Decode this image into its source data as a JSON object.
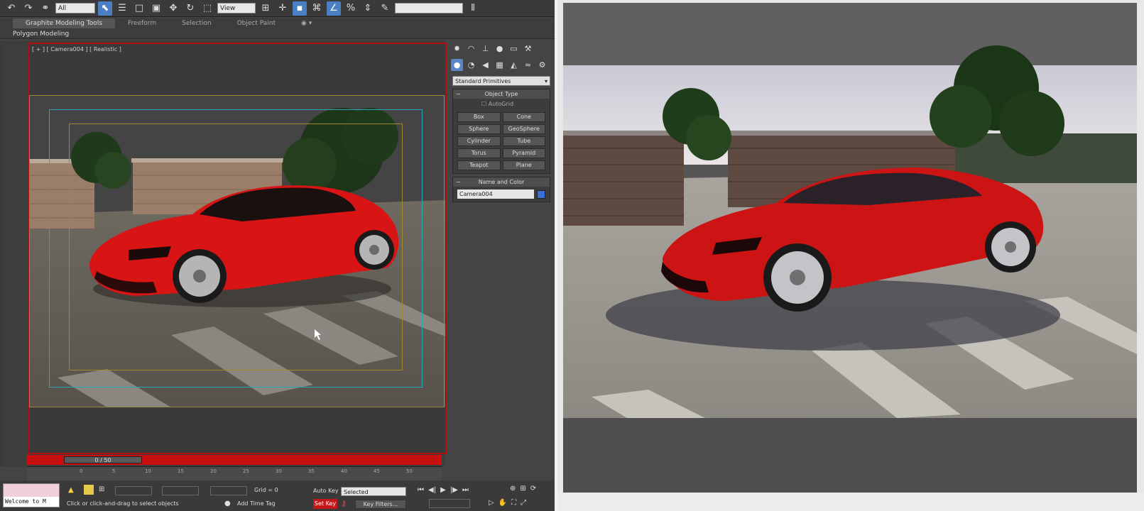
{
  "toolbar": {
    "filter_drop": "All",
    "view_drop": "View"
  },
  "ribbon": {
    "tabs": [
      "Graphite Modeling Tools",
      "Freeform",
      "Selection",
      "Object Paint"
    ],
    "subtitle": "Polygon Modeling"
  },
  "viewport": {
    "label": "[ + ] [ Camera004 ] [ Realistic ]",
    "time_slider": "0 / 50"
  },
  "command_panel": {
    "category_drop": "Standard Primitives",
    "object_type_title": "Object Type",
    "autogrid": "AutoGrid",
    "buttons": [
      "Box",
      "Cone",
      "Sphere",
      "GeoSphere",
      "Cylinder",
      "Tube",
      "Torus",
      "Pyramid",
      "Teapot",
      "Plane"
    ],
    "name_color_title": "Name and Color",
    "name_value": "Camera004",
    "swatch_color": "#3a70d8"
  },
  "timeline": {
    "ticks": [
      "0",
      "5",
      "10",
      "15",
      "20",
      "25",
      "30",
      "35",
      "40",
      "45",
      "50"
    ]
  },
  "status": {
    "welcome": "Welcome to M",
    "message": "Click or click-and-drag to select objects",
    "add_time_tag": "Add Time Tag",
    "grid": "Grid = 0",
    "auto_key": "Auto Key",
    "selected": "Selected",
    "set_key": "Set Key",
    "key_filters": "Key Filters..."
  },
  "colors": {
    "car_red": "#d81414",
    "set_key_red": "#c41818",
    "active_blue": "#4a7fc1"
  }
}
